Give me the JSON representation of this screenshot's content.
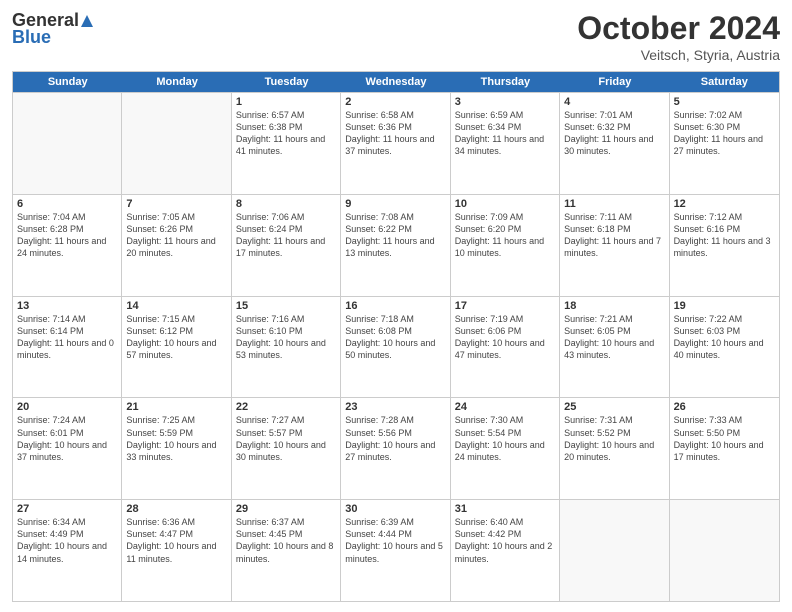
{
  "header": {
    "logo_general": "General",
    "logo_blue": "Blue",
    "title": "October 2024",
    "location": "Veitsch, Styria, Austria"
  },
  "weekdays": [
    "Sunday",
    "Monday",
    "Tuesday",
    "Wednesday",
    "Thursday",
    "Friday",
    "Saturday"
  ],
  "weeks": [
    [
      {
        "day": "",
        "info": ""
      },
      {
        "day": "",
        "info": ""
      },
      {
        "day": "1",
        "info": "Sunrise: 6:57 AM\nSunset: 6:38 PM\nDaylight: 11 hours and 41 minutes."
      },
      {
        "day": "2",
        "info": "Sunrise: 6:58 AM\nSunset: 6:36 PM\nDaylight: 11 hours and 37 minutes."
      },
      {
        "day": "3",
        "info": "Sunrise: 6:59 AM\nSunset: 6:34 PM\nDaylight: 11 hours and 34 minutes."
      },
      {
        "day": "4",
        "info": "Sunrise: 7:01 AM\nSunset: 6:32 PM\nDaylight: 11 hours and 30 minutes."
      },
      {
        "day": "5",
        "info": "Sunrise: 7:02 AM\nSunset: 6:30 PM\nDaylight: 11 hours and 27 minutes."
      }
    ],
    [
      {
        "day": "6",
        "info": "Sunrise: 7:04 AM\nSunset: 6:28 PM\nDaylight: 11 hours and 24 minutes."
      },
      {
        "day": "7",
        "info": "Sunrise: 7:05 AM\nSunset: 6:26 PM\nDaylight: 11 hours and 20 minutes."
      },
      {
        "day": "8",
        "info": "Sunrise: 7:06 AM\nSunset: 6:24 PM\nDaylight: 11 hours and 17 minutes."
      },
      {
        "day": "9",
        "info": "Sunrise: 7:08 AM\nSunset: 6:22 PM\nDaylight: 11 hours and 13 minutes."
      },
      {
        "day": "10",
        "info": "Sunrise: 7:09 AM\nSunset: 6:20 PM\nDaylight: 11 hours and 10 minutes."
      },
      {
        "day": "11",
        "info": "Sunrise: 7:11 AM\nSunset: 6:18 PM\nDaylight: 11 hours and 7 minutes."
      },
      {
        "day": "12",
        "info": "Sunrise: 7:12 AM\nSunset: 6:16 PM\nDaylight: 11 hours and 3 minutes."
      }
    ],
    [
      {
        "day": "13",
        "info": "Sunrise: 7:14 AM\nSunset: 6:14 PM\nDaylight: 11 hours and 0 minutes."
      },
      {
        "day": "14",
        "info": "Sunrise: 7:15 AM\nSunset: 6:12 PM\nDaylight: 10 hours and 57 minutes."
      },
      {
        "day": "15",
        "info": "Sunrise: 7:16 AM\nSunset: 6:10 PM\nDaylight: 10 hours and 53 minutes."
      },
      {
        "day": "16",
        "info": "Sunrise: 7:18 AM\nSunset: 6:08 PM\nDaylight: 10 hours and 50 minutes."
      },
      {
        "day": "17",
        "info": "Sunrise: 7:19 AM\nSunset: 6:06 PM\nDaylight: 10 hours and 47 minutes."
      },
      {
        "day": "18",
        "info": "Sunrise: 7:21 AM\nSunset: 6:05 PM\nDaylight: 10 hours and 43 minutes."
      },
      {
        "day": "19",
        "info": "Sunrise: 7:22 AM\nSunset: 6:03 PM\nDaylight: 10 hours and 40 minutes."
      }
    ],
    [
      {
        "day": "20",
        "info": "Sunrise: 7:24 AM\nSunset: 6:01 PM\nDaylight: 10 hours and 37 minutes."
      },
      {
        "day": "21",
        "info": "Sunrise: 7:25 AM\nSunset: 5:59 PM\nDaylight: 10 hours and 33 minutes."
      },
      {
        "day": "22",
        "info": "Sunrise: 7:27 AM\nSunset: 5:57 PM\nDaylight: 10 hours and 30 minutes."
      },
      {
        "day": "23",
        "info": "Sunrise: 7:28 AM\nSunset: 5:56 PM\nDaylight: 10 hours and 27 minutes."
      },
      {
        "day": "24",
        "info": "Sunrise: 7:30 AM\nSunset: 5:54 PM\nDaylight: 10 hours and 24 minutes."
      },
      {
        "day": "25",
        "info": "Sunrise: 7:31 AM\nSunset: 5:52 PM\nDaylight: 10 hours and 20 minutes."
      },
      {
        "day": "26",
        "info": "Sunrise: 7:33 AM\nSunset: 5:50 PM\nDaylight: 10 hours and 17 minutes."
      }
    ],
    [
      {
        "day": "27",
        "info": "Sunrise: 6:34 AM\nSunset: 4:49 PM\nDaylight: 10 hours and 14 minutes."
      },
      {
        "day": "28",
        "info": "Sunrise: 6:36 AM\nSunset: 4:47 PM\nDaylight: 10 hours and 11 minutes."
      },
      {
        "day": "29",
        "info": "Sunrise: 6:37 AM\nSunset: 4:45 PM\nDaylight: 10 hours and 8 minutes."
      },
      {
        "day": "30",
        "info": "Sunrise: 6:39 AM\nSunset: 4:44 PM\nDaylight: 10 hours and 5 minutes."
      },
      {
        "day": "31",
        "info": "Sunrise: 6:40 AM\nSunset: 4:42 PM\nDaylight: 10 hours and 2 minutes."
      },
      {
        "day": "",
        "info": ""
      },
      {
        "day": "",
        "info": ""
      }
    ]
  ]
}
